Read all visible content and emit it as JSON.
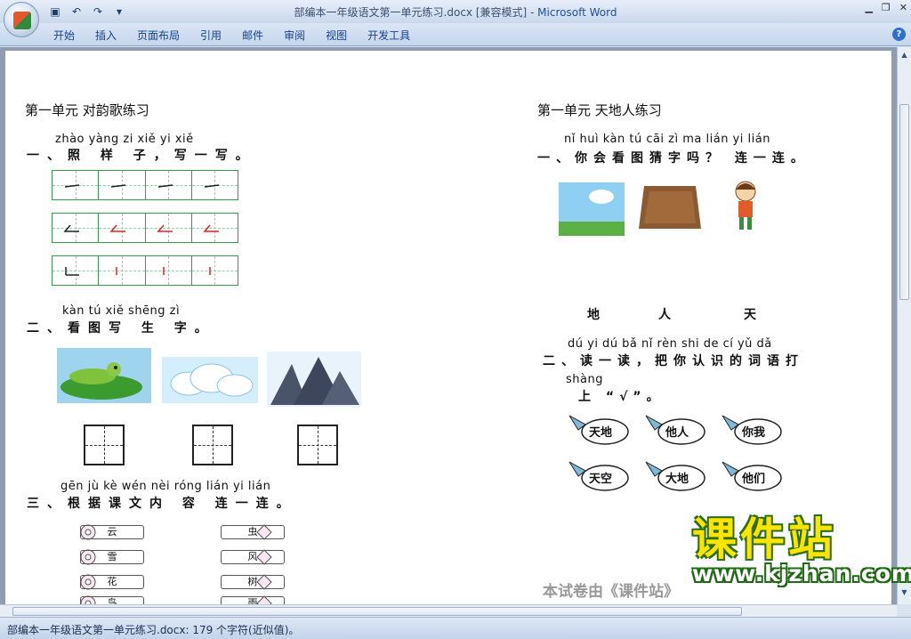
{
  "window": {
    "doc_title": "部编本一年级语文第一单元练习.docx [兼容模式] - ",
    "app_name": "Microsoft Word"
  },
  "ribbon": {
    "tabs": [
      "开始",
      "插入",
      "页面布局",
      "引用",
      "邮件",
      "审阅",
      "视图",
      "开发工具"
    ],
    "help": "?"
  },
  "left": {
    "title": "第一单元         对韵歌练习",
    "q1_pinyin": "zhào yàng zi   xiě yi xiě",
    "q1_text": "一、照 样 子，写一写。",
    "q2_pinyin": "kàn tú xiě shēng zì",
    "q2_text": "二、看图写 生 字。",
    "q3_pinyin": "gēn jù kè wén nèi róng lián yi lián",
    "q3_text": "三、根据课文内 容 连一连。",
    "left_cards": [
      "云",
      "雪",
      "花",
      "鸟"
    ],
    "right_cards": [
      "虫",
      "风",
      "树",
      "雨"
    ]
  },
  "right": {
    "title": "第一单元      天地人练习",
    "q1_pinyin": "nǐ huì kàn tú cāi zì ma     lián yi lián",
    "q1_text": "一、你会看图猜字吗？ 连一连。",
    "words": [
      "地",
      "人",
      "天"
    ],
    "q2_pinyin": "dú yi dú   bǎ nǐ rèn shi de cí yǔ dǎ",
    "q2_text": "二、读一读，把你认识的词语打",
    "q2_pinyin2": "shàng",
    "q2_text2": "上 “√”。",
    "birds": [
      "天地",
      "他人",
      "你我",
      "天空",
      "大地",
      "他们"
    ],
    "footer": "本试卷由《课件站》"
  },
  "watermark": {
    "name": "课件站",
    "url": "www.kjzhan.com"
  },
  "status": {
    "text": "部编本一年级语文第一单元练习.docx: 179 个字符(近似值)。"
  }
}
